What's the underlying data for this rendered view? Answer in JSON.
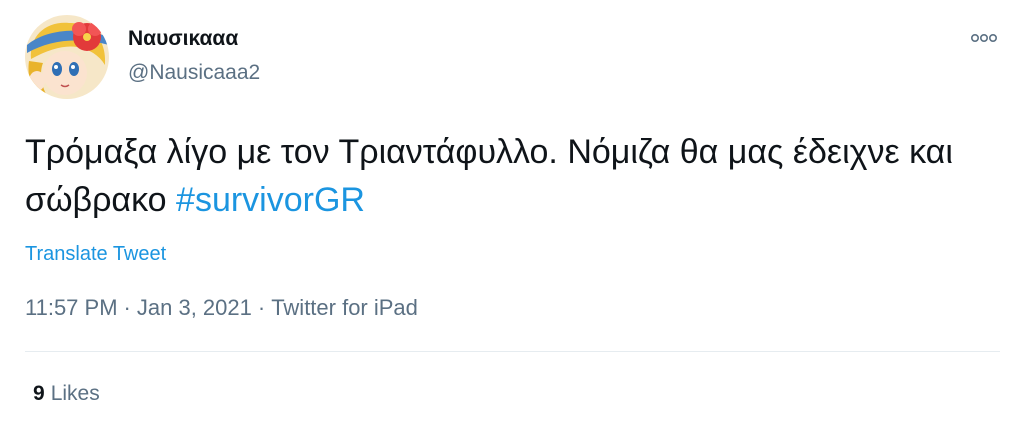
{
  "author": {
    "display_name": "Ναυσικααα",
    "handle": "@Nausicaaa2",
    "avatar_icon": "anime-avatar-icon"
  },
  "tweet": {
    "text_before_hashtag": "Τρόμαξα λίγο με τον Τριαντάφυλλο. Νόμιζα θα μας έδειχνε και σώβρακο ",
    "hashtag": "#survivorGR",
    "translate_label": "Translate Tweet",
    "time": "11:57 PM",
    "separator": "·",
    "date": "Jan 3, 2021",
    "source": "Twitter for iPad"
  },
  "engagement": {
    "likes_count": "9",
    "likes_label": "Likes"
  },
  "colors": {
    "link": "#1b95e0",
    "secondary_text": "#5b7083",
    "primary_text": "#0f1419",
    "divider": "#e6ecf0"
  },
  "icons": {
    "more": "more-options-icon"
  }
}
